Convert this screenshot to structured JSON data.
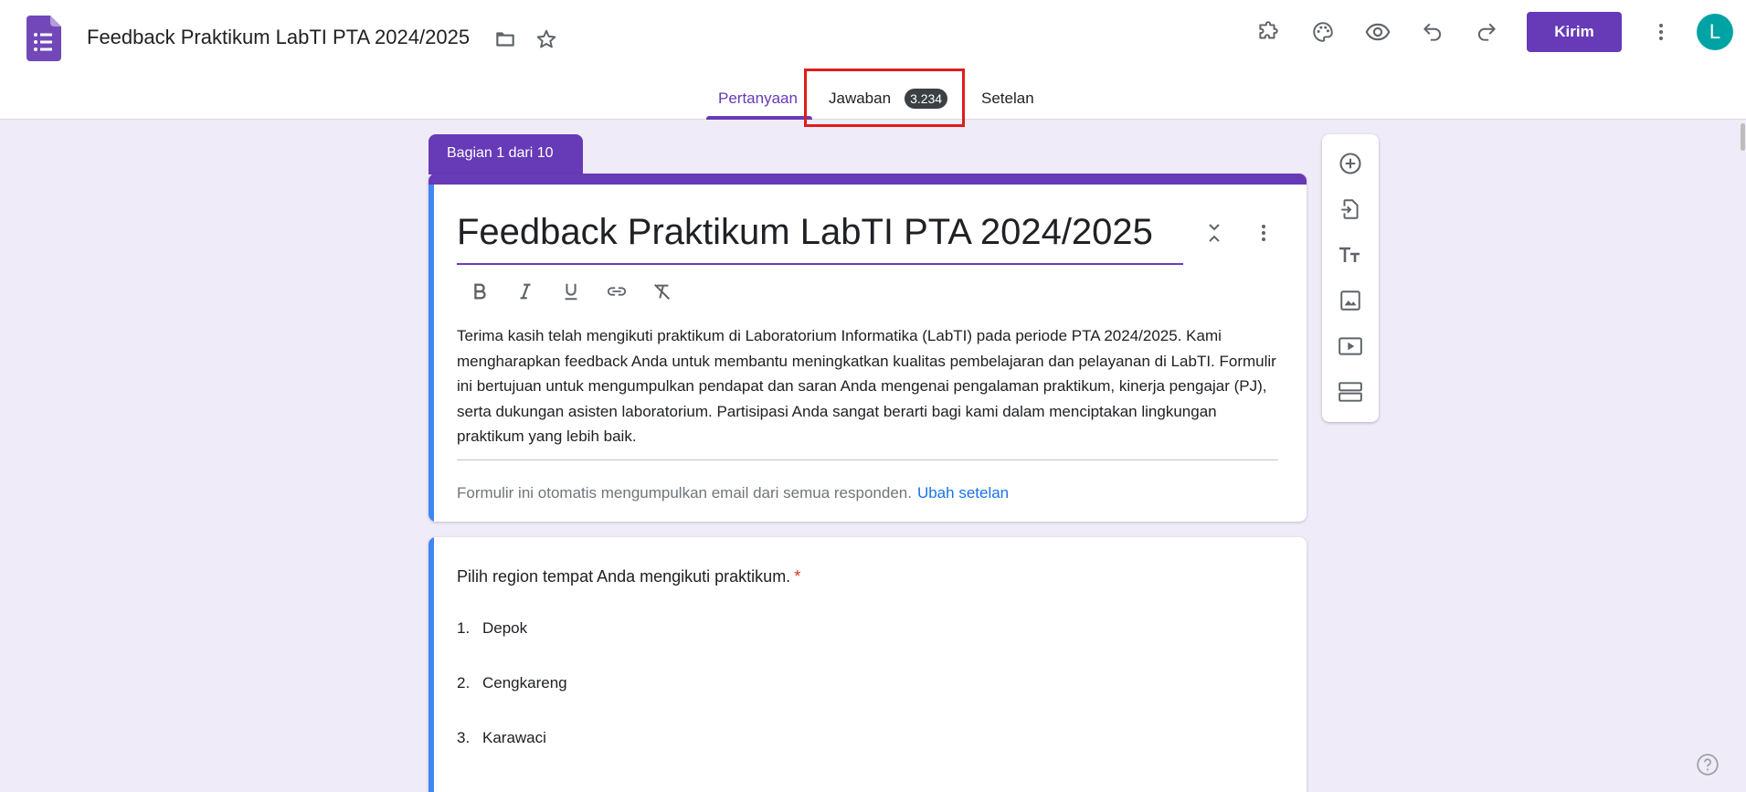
{
  "header": {
    "doc_title": "Feedback Praktikum LabTI PTA 2024/2025",
    "send_label": "Kirim",
    "avatar_letter": "L"
  },
  "tabs": {
    "questions": "Pertanyaan",
    "responses": "Jawaban",
    "responses_count": "3.234",
    "settings": "Setelan"
  },
  "section": {
    "label": "Bagian 1 dari 10"
  },
  "form": {
    "title": "Feedback Praktikum LabTI PTA 2024/2025",
    "description": "Terima kasih telah mengikuti praktikum di Laboratorium Informatika (LabTI) pada periode PTA 2024/2025. Kami mengharapkan feedback Anda untuk membantu meningkatkan kualitas pembelajaran dan pelayanan di LabTI. Formulir ini bertujuan untuk mengumpulkan pendapat dan saran Anda mengenai pengalaman praktikum, kinerja pengajar (PJ), serta dukungan asisten laboratorium. Partisipasi Anda sangat berarti bagi kami dalam menciptakan lingkungan praktikum yang lebih baik.",
    "email_note": "Formulir ini otomatis mengumpulkan email dari semua responden.",
    "email_link": "Ubah setelan"
  },
  "question": {
    "title": "Pilih region tempat Anda mengikuti praktikum.",
    "required_mark": "*",
    "options": [
      {
        "num": "1.",
        "label": "Depok"
      },
      {
        "num": "2.",
        "label": "Cengkareng"
      },
      {
        "num": "3.",
        "label": "Karawaci"
      }
    ]
  },
  "colors": {
    "brand": "#673ab7",
    "accent_blue": "#4285f4",
    "highlight": "#e01c1c",
    "background": "#f0ebf8"
  },
  "icons": {
    "header": [
      "forms-app-icon",
      "folder-icon",
      "star-icon",
      "addon-icon",
      "palette-icon",
      "preview-eye-icon",
      "undo-icon",
      "redo-icon",
      "more-vert-icon"
    ],
    "toolbar": [
      "add-question-icon",
      "import-questions-icon",
      "add-title-icon",
      "add-image-icon",
      "add-video-icon",
      "add-section-icon"
    ]
  }
}
